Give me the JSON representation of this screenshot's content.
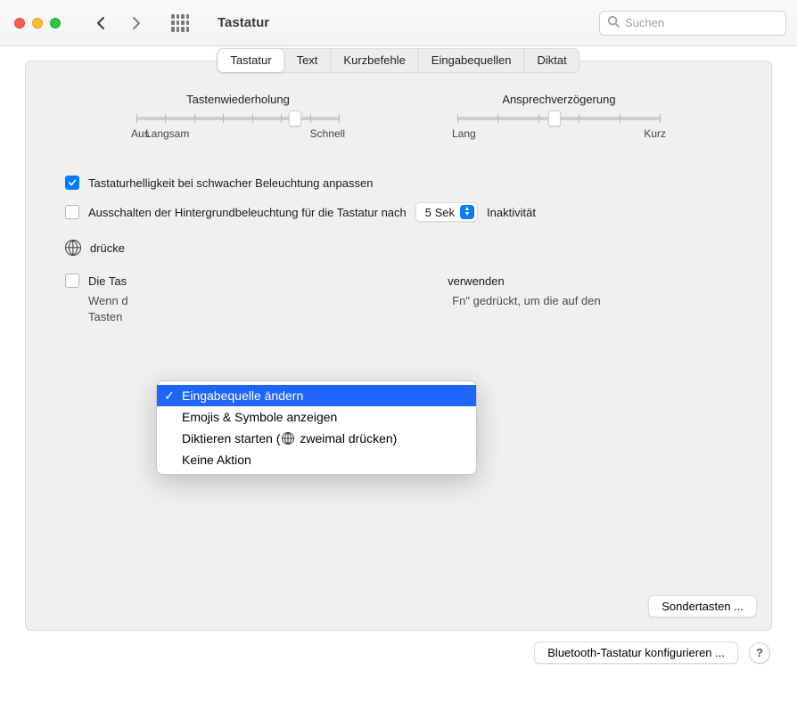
{
  "window": {
    "title": "Tastatur"
  },
  "search": {
    "placeholder": "Suchen"
  },
  "tabs": {
    "keyboard": "Tastatur",
    "text": "Text",
    "shortcuts": "Kurzbefehle",
    "input_sources": "Eingabequellen",
    "dictation": "Diktat"
  },
  "sliders": {
    "repeat": {
      "title": "Tastenwiederholung",
      "left": "Aus",
      "mid": "Langsam",
      "right": "Schnell"
    },
    "delay": {
      "title": "Ansprechverzögerung",
      "left": "Lang",
      "right": "Kurz"
    }
  },
  "options": {
    "auto_brightness": "Tastaturhelligkeit bei schwacher Beleuchtung anpassen",
    "backlight_off": "Ausschalten der Hintergrundbeleuchtung für die Tastatur nach",
    "backlight_off_value": "5 Sek",
    "backlight_after": "Inaktivität",
    "globe_prefix": "drücke",
    "fn_standard": "Die Tas",
    "fn_standard_tail": "verwenden",
    "fn_note_a": "Wenn d",
    "fn_note_b": "Fn\" gedrückt, um die auf den",
    "fn_note_c": "Tasten"
  },
  "menu": {
    "change_input": "Eingabequelle ändern",
    "emoji": "Emojis & Symbole anzeigen",
    "dictation_pre": "Diktieren starten (",
    "dictation_post": " zweimal drücken)",
    "none": "Keine Aktion"
  },
  "buttons": {
    "modifier": "Sondertasten ...",
    "bluetooth": "Bluetooth-Tastatur konfigurieren ..."
  }
}
